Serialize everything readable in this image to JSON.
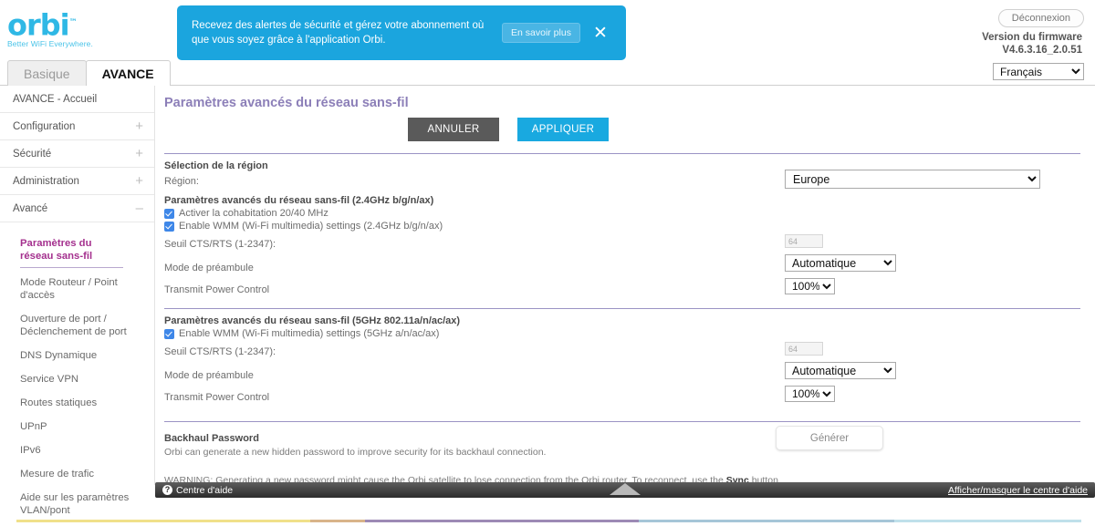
{
  "header": {
    "logo": {
      "name": "orbi",
      "tm": "™",
      "tagline": "Better WiFi Everywhere."
    },
    "banner": {
      "text": "Recevez des alertes de sécurité et gérez votre abonnement où que vous soyez grâce à l'application Orbi.",
      "button": "En savoir plus",
      "close": "✕"
    },
    "logout": "Déconnexion",
    "firmware_label": "Version du firmware",
    "firmware_version": "V4.6.3.16_2.0.51",
    "language": "Français"
  },
  "tabs": [
    {
      "label": "Basique",
      "active": false
    },
    {
      "label": "AVANCE",
      "active": true
    }
  ],
  "sidebar": {
    "top_items": [
      {
        "label": "AVANCE - Accueil",
        "expander": ""
      },
      {
        "label": "Configuration",
        "expander": "+"
      },
      {
        "label": "Sécurité",
        "expander": "+"
      },
      {
        "label": "Administration",
        "expander": "+"
      },
      {
        "label": "Avancé",
        "expander": "–"
      }
    ],
    "sub_items": [
      {
        "label": "Paramètres du réseau sans-fil",
        "active": true
      },
      {
        "label": "Mode Routeur / Point d'accès",
        "active": false
      },
      {
        "label": "Ouverture de port / Déclenchement de port",
        "active": false
      },
      {
        "label": "DNS Dynamique",
        "active": false
      },
      {
        "label": "Service VPN",
        "active": false
      },
      {
        "label": "Routes statiques",
        "active": false
      },
      {
        "label": "UPnP",
        "active": false
      },
      {
        "label": "IPv6",
        "active": false
      },
      {
        "label": "Mesure de trafic",
        "active": false
      },
      {
        "label": "Aide sur les paramètres VLAN/pont",
        "active": false
      }
    ]
  },
  "main": {
    "page_title": "Paramètres avancés du réseau sans-fil",
    "cancel_button": "ANNULER",
    "apply_button": "APPLIQUER",
    "region_section": {
      "title": "Sélection de la région",
      "region_label": "Région:",
      "region_value": "Europe"
    },
    "band24": {
      "title": "Paramètres avancés du réseau sans-fil (2.4GHz b/g/n/ax)",
      "coexistence_label": "Activer la cohabitation 20/40 MHz",
      "coexistence_checked": true,
      "wmm_label": "Enable WMM (Wi-Fi multimedia) settings (2.4GHz b/g/n/ax)",
      "wmm_checked": true,
      "cts_label": "Seuil CTS/RTS (1-2347):",
      "cts_value": "64",
      "preamble_label": "Mode de préambule",
      "preamble_value": "Automatique",
      "power_label": "Transmit Power Control",
      "power_value": "100%"
    },
    "band5": {
      "title": "Paramètres avancés du réseau sans-fil (5GHz 802.11a/n/ac/ax)",
      "wmm_label": "Enable WMM (Wi-Fi multimedia) settings (5GHz a/n/ac/ax)",
      "wmm_checked": true,
      "cts_label": "Seuil CTS/RTS (1-2347):",
      "cts_value": "64",
      "preamble_label": "Mode de préambule",
      "preamble_value": "Automatique",
      "power_label": "Transmit Power Control",
      "power_value": "100%"
    },
    "backhaul": {
      "title": "Backhaul Password",
      "description": "Orbi can generate a new hidden password to improve security for its backhaul connection.",
      "warning_before": "WARNING: Generating a new password might cause the Orbi satellite to lose connection from the Orbi router. To reconnect, use the ",
      "warning_bold": "Sync",
      "warning_after": " button",
      "generate_button": "Générer"
    }
  },
  "footer": {
    "help_center": "Centre d'aide",
    "help_icon": "?",
    "toggle_link": "Afficher/masquer le centre d'aide"
  },
  "colors": {
    "accent_blue": "#19a9e0",
    "title_purple": "#8c7fb8",
    "active_nav": "#a4308e",
    "checkbox_blue": "#3e87e8"
  }
}
